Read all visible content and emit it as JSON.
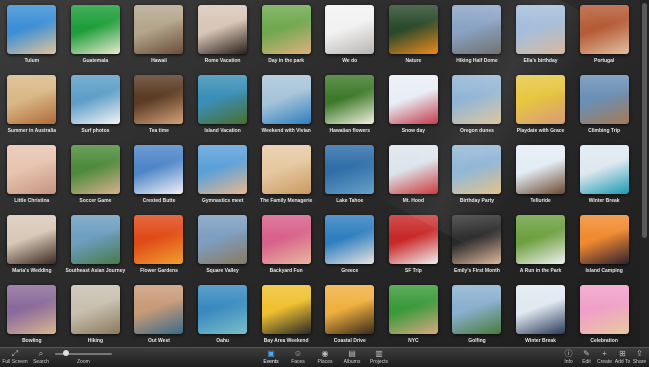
{
  "events": [
    {
      "name": "Tulum",
      "colors": [
        "#3b8fd6",
        "#e3c39b"
      ]
    },
    {
      "name": "Guatemala",
      "colors": [
        "#1e9e3a",
        "#ece8d2"
      ]
    },
    {
      "name": "Hawaii",
      "colors": [
        "#b4a68d",
        "#6b4d3b"
      ]
    },
    {
      "name": "Rome Vacation",
      "colors": [
        "#d8c6b8",
        "#2a1f1a"
      ]
    },
    {
      "name": "Day in the park",
      "colors": [
        "#6fa84e",
        "#e0b07f"
      ]
    },
    {
      "name": "We do",
      "colors": [
        "#f2f2f2",
        "#b8b4b0"
      ]
    },
    {
      "name": "Nature",
      "colors": [
        "#2b4a2c",
        "#f08b1c"
      ]
    },
    {
      "name": "Hiking Half Dome",
      "colors": [
        "#8aa3c4",
        "#6b6b6b"
      ]
    },
    {
      "name": "Ella's birthday",
      "colors": [
        "#9fb9d8",
        "#d7b79a"
      ]
    },
    {
      "name": "Portugal",
      "colors": [
        "#b45a34",
        "#e4c0a2"
      ]
    },
    {
      "name": "Summer in Australia",
      "colors": [
        "#d9b887",
        "#b06b38"
      ]
    },
    {
      "name": "Surf photos",
      "colors": [
        "#5d9ec8",
        "#f4f4f4"
      ]
    },
    {
      "name": "Tea time",
      "colors": [
        "#5a3b24",
        "#d4a37b"
      ]
    },
    {
      "name": "Island Vacation",
      "colors": [
        "#3a8fb8",
        "#4a6e2e"
      ]
    },
    {
      "name": "Weekend with Vivian",
      "colors": [
        "#a8c4d9",
        "#2f7fbf"
      ]
    },
    {
      "name": "Hawaiian flowers",
      "colors": [
        "#3e7a2a",
        "#f0f0e0"
      ]
    },
    {
      "name": "Snow day",
      "colors": [
        "#e8eef5",
        "#c23a4a"
      ]
    },
    {
      "name": "Oregon dunes",
      "colors": [
        "#8fb3d4",
        "#d9c39a"
      ]
    },
    {
      "name": "Playdate with Grace",
      "colors": [
        "#e6c43a",
        "#d79a7a"
      ]
    },
    {
      "name": "Climbing Trip",
      "colors": [
        "#6b8fb5",
        "#a57a55"
      ]
    },
    {
      "name": "Little Christina",
      "colors": [
        "#e8c4b0",
        "#c49480"
      ]
    },
    {
      "name": "Soccer Game",
      "colors": [
        "#4d8a3a",
        "#d8b090"
      ]
    },
    {
      "name": "Crested Butte",
      "colors": [
        "#4f86c8",
        "#f0f2f5"
      ]
    },
    {
      "name": "Gymnastics meet",
      "colors": [
        "#5ca0d8",
        "#e8b890"
      ]
    },
    {
      "name": "The Family Menagerie",
      "colors": [
        "#e6c9a3",
        "#c89a62"
      ]
    },
    {
      "name": "Lake Tahoe",
      "colors": [
        "#2f6ea8",
        "#6aa0c8"
      ]
    },
    {
      "name": "Mt. Hood",
      "colors": [
        "#dde4ec",
        "#c83030"
      ]
    },
    {
      "name": "Birthday Party",
      "colors": [
        "#8ab3d4",
        "#e4c28a"
      ]
    },
    {
      "name": "Telluride",
      "colors": [
        "#e4ecf4",
        "#6a4a30"
      ]
    },
    {
      "name": "Winter Break",
      "colors": [
        "#dfe8f0",
        "#1a9ab0"
      ]
    },
    {
      "name": "Maria's Wedding",
      "colors": [
        "#d8c8b8",
        "#3a2a22"
      ]
    },
    {
      "name": "Southeast Asian Journey",
      "colors": [
        "#6d9ec0",
        "#4a7a4a"
      ]
    },
    {
      "name": "Flower Gardens",
      "colors": [
        "#e04a18",
        "#f0a030"
      ]
    },
    {
      "name": "Square Valley",
      "colors": [
        "#7d9ec0",
        "#8a7a62"
      ]
    },
    {
      "name": "Backyard Fun",
      "colors": [
        "#d8608a",
        "#e8b8a0"
      ]
    },
    {
      "name": "Greece",
      "colors": [
        "#2f7fc0",
        "#e8e4de"
      ]
    },
    {
      "name": "SF Trip",
      "colors": [
        "#c82828",
        "#f0f0f0"
      ]
    },
    {
      "name": "Emily's First Month",
      "colors": [
        "#2a2a2a",
        "#e0b8a0"
      ]
    },
    {
      "name": "A Run in the Park",
      "colors": [
        "#6ea040",
        "#f0f0f0"
      ]
    },
    {
      "name": "Island Camping",
      "colors": [
        "#f08a30",
        "#302030"
      ]
    },
    {
      "name": "Bowling",
      "colors": [
        "#8a6a9a",
        "#d8b890"
      ]
    },
    {
      "name": "Hiking",
      "colors": [
        "#c8c0b0",
        "#8a7a5a"
      ]
    },
    {
      "name": "Out West",
      "colors": [
        "#c89a78",
        "#3a6a8a"
      ]
    },
    {
      "name": "Oahu",
      "colors": [
        "#3a8ac0",
        "#7ac0c8"
      ]
    },
    {
      "name": "Bay Area Weekend",
      "colors": [
        "#f0c030",
        "#2a2a2a"
      ]
    },
    {
      "name": "Coastal Drive",
      "colors": [
        "#f0b040",
        "#3a2a1a"
      ]
    },
    {
      "name": "NYC",
      "colors": [
        "#3a9a3a",
        "#d8a880"
      ]
    },
    {
      "name": "Golfing",
      "colors": [
        "#8ab0d0",
        "#4a7a3a"
      ]
    },
    {
      "name": "Winter Break",
      "colors": [
        "#e0e8f0",
        "#2a3a5a"
      ]
    },
    {
      "name": "Celebration",
      "colors": [
        "#f0a0c8",
        "#e8c8a0"
      ]
    }
  ],
  "toolbar": {
    "left": [
      {
        "name": "full-screen-button",
        "icon": "expand-icon",
        "glyph": "⤢",
        "label": "Full Screen"
      },
      {
        "name": "search-button",
        "icon": "search-icon",
        "glyph": "⌕",
        "label": "Search"
      }
    ],
    "zoom": {
      "label": "Zoom",
      "value": 0.2
    },
    "center": [
      {
        "name": "tab-events",
        "icon": "events-icon",
        "glyph": "▣",
        "label": "Events",
        "active": true
      },
      {
        "name": "tab-faces",
        "icon": "faces-icon",
        "glyph": "☺",
        "label": "Faces",
        "active": false
      },
      {
        "name": "tab-places",
        "icon": "places-icon",
        "glyph": "◉",
        "label": "Places",
        "active": false
      },
      {
        "name": "tab-albums",
        "icon": "albums-icon",
        "glyph": "▤",
        "label": "Albums",
        "active": false
      },
      {
        "name": "tab-projects",
        "icon": "projects-icon",
        "glyph": "▥",
        "label": "Projects",
        "active": false
      }
    ],
    "right": [
      {
        "name": "info-button",
        "icon": "info-icon",
        "glyph": "ⓘ",
        "label": "Info"
      },
      {
        "name": "edit-button",
        "icon": "pencil-icon",
        "glyph": "✎",
        "label": "Edit"
      },
      {
        "name": "create-button",
        "icon": "plus-icon",
        "glyph": "+",
        "label": "Create"
      },
      {
        "name": "add-to-button",
        "icon": "add-to-icon",
        "glyph": "⊞",
        "label": "Add To"
      },
      {
        "name": "share-button",
        "icon": "share-icon",
        "glyph": "⇪",
        "label": "Share"
      }
    ]
  }
}
